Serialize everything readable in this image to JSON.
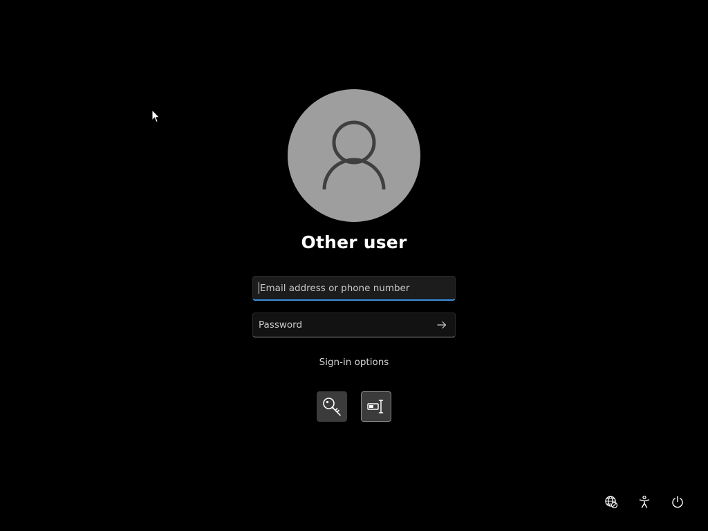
{
  "user": {
    "name": "Other user",
    "avatar_icon": "person-icon"
  },
  "email_field": {
    "value": "",
    "placeholder": "Email address or phone number",
    "focused": true,
    "accent_color": "#3b8fdc"
  },
  "password_field": {
    "value": "",
    "placeholder": "Password",
    "submit_icon": "arrow-right-icon"
  },
  "sign_in_options": {
    "label": "Sign-in options",
    "options": [
      {
        "name": "password",
        "icon": "key-icon"
      },
      {
        "name": "security key",
        "icon": "security-key-icon"
      }
    ]
  },
  "system_tray": {
    "icons": [
      "network-icon",
      "accessibility-icon",
      "power-icon"
    ]
  }
}
